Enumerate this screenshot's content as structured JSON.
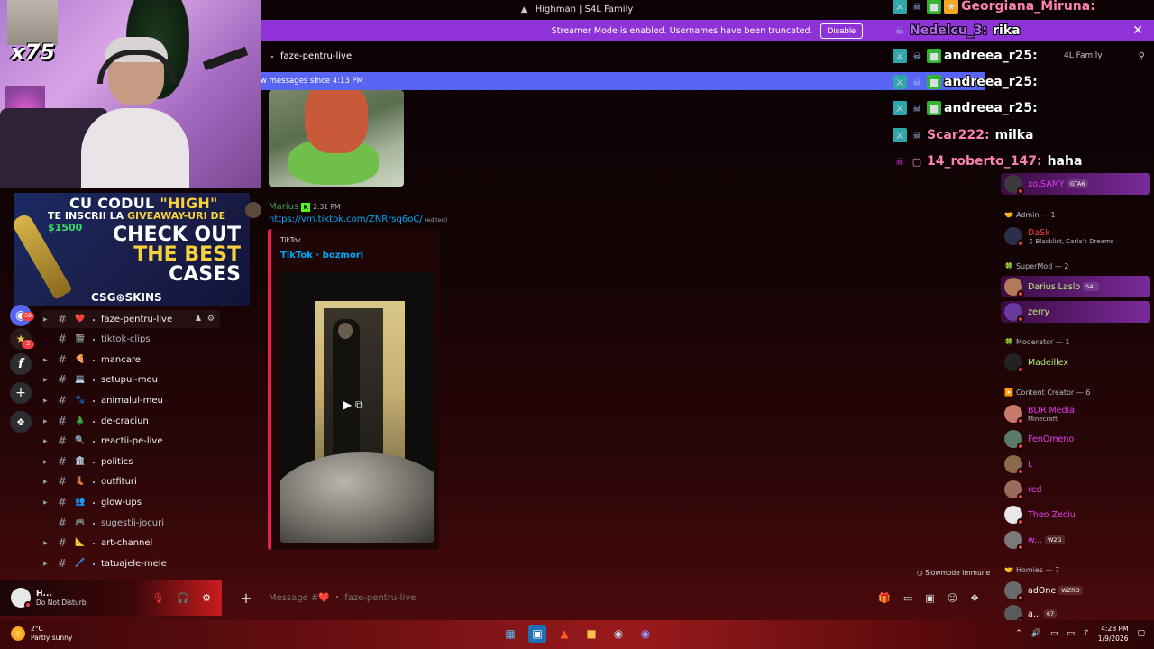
{
  "window": {
    "title": "Highman | S4L Family"
  },
  "streamer_banner": {
    "text": "Streamer Mode is enabled. Usernames have been truncated.",
    "disable_label": "Disable"
  },
  "channel_header": {
    "name": "faze-pentru-live"
  },
  "new_messages_bar": {
    "text": "w messages since 4:13 PM"
  },
  "right_header": {
    "server_name": "4L Family"
  },
  "overlay": {
    "multiplier": "x75"
  },
  "sponsor": {
    "line1_pre": "CU CODUL ",
    "line1_code": "\"HIGH\"",
    "line2_pre": "TE INSCRII LA ",
    "line2_mid": "GIVEAWAY-URI DE ",
    "line2_amount": "$1500",
    "cta_1": "CHECK OUT",
    "cta_2": "THE BEST",
    "cta_3": "CASES",
    "brand": "CSG⊛SKINS"
  },
  "server_rail": {
    "badges": [
      "58",
      "3"
    ]
  },
  "channels": [
    {
      "name": "faze-pentru-live",
      "emoji": "❤️",
      "active": true,
      "muted": false
    },
    {
      "name": "tiktok-clips",
      "emoji": "🎬",
      "active": false,
      "muted": true
    },
    {
      "name": "mancare",
      "emoji": "🍕",
      "active": false,
      "muted": false
    },
    {
      "name": "setupul-meu",
      "emoji": "💻",
      "active": false,
      "muted": false
    },
    {
      "name": "animalul-meu",
      "emoji": "🐾",
      "active": false,
      "muted": false
    },
    {
      "name": "de-craciun",
      "emoji": "🎄",
      "active": false,
      "muted": false
    },
    {
      "name": "reactii-pe-live",
      "emoji": "🔍",
      "active": false,
      "muted": false
    },
    {
      "name": "politics",
      "emoji": "🏛️",
      "active": false,
      "muted": false
    },
    {
      "name": "outfituri",
      "emoji": "👢",
      "active": false,
      "muted": false
    },
    {
      "name": "glow-ups",
      "emoji": "👥",
      "active": false,
      "muted": false
    },
    {
      "name": "sugestii-jocuri",
      "emoji": "🎮",
      "active": false,
      "muted": true
    },
    {
      "name": "art-channel",
      "emoji": "📐",
      "active": false,
      "muted": false
    },
    {
      "name": "tatuajele-mele",
      "emoji": "🖊️",
      "active": false,
      "muted": false
    }
  ],
  "user_panel": {
    "name": "H...",
    "status": "Do Not Disturb"
  },
  "message": {
    "author": "Marius",
    "time": "2:31 PM",
    "link": "https://vm.tiktok.com/ZNRrsq6oC/",
    "edited": "(edited)",
    "embed_provider": "TikTok",
    "embed_title": "TikTok · bozmori"
  },
  "slowmode": "Slowmode Immune",
  "composer": {
    "placeholder": "Message #❤️ ・ faze-pentru-live"
  },
  "member_groups": [
    {
      "label": "Admin — 1",
      "icon": "🤝"
    },
    {
      "label": "SuperMod — 2",
      "icon": "🍀"
    },
    {
      "label": "Moderator — 1",
      "icon": "🍀"
    },
    {
      "label": "Content Creator — 6",
      "icon": "▶️"
    },
    {
      "label": "Homies — 7",
      "icon": "🤝"
    }
  ],
  "members": [
    {
      "name": "xo.SAMY",
      "sub": "",
      "tag": "GTA6",
      "color": "#e23cf0",
      "avatar": "#3b3b3b",
      "highlight": true
    },
    {
      "name": "DaSk",
      "sub": "♫ Blacklist, Carla's Dreams",
      "tag": "",
      "color": "#f23f43",
      "avatar": "#2c2f4a",
      "highlight": false
    },
    {
      "name": "Darius Laslo",
      "sub": "",
      "tag": "S4L",
      "color": "#b9f27c",
      "avatar": "#b37a5a",
      "highlight": true
    },
    {
      "name": "zerry",
      "sub": "",
      "tag": "",
      "color": "#b9f27c",
      "avatar": "#6b3aa0",
      "highlight": true
    },
    {
      "name": "Madeillex",
      "sub": "",
      "tag": "",
      "color": "#b9f27c",
      "avatar": "#222222",
      "highlight": false
    },
    {
      "name": "BDR Media",
      "sub": "Minecraft",
      "tag": "",
      "color": "#e23cf0",
      "avatar": "#c77a6a",
      "highlight": false
    },
    {
      "name": "FenOmeno",
      "sub": "",
      "tag": "",
      "color": "#e23cf0",
      "avatar": "#5a7a6a",
      "highlight": false
    },
    {
      "name": "L",
      "sub": "",
      "tag": "",
      "color": "#e23cf0",
      "avatar": "#8a6a4a",
      "highlight": false
    },
    {
      "name": "red",
      "sub": "",
      "tag": "",
      "color": "#e23cf0",
      "avatar": "#9a6a5a",
      "highlight": false
    },
    {
      "name": "Theo Zeciu",
      "sub": "",
      "tag": "",
      "color": "#e23cf0",
      "avatar": "#e8e8e8",
      "highlight": false
    },
    {
      "name": "w...",
      "sub": "",
      "tag": "W2G",
      "color": "#e23cf0",
      "avatar": "#7a7a7a",
      "highlight": false
    },
    {
      "name": "adOne",
      "sub": "",
      "tag": "WZRO",
      "color": "#ffffff",
      "avatar": "#6a6a6a",
      "highlight": false
    },
    {
      "name": "a...",
      "sub": "",
      "tag": "67",
      "color": "#ffffff",
      "avatar": "#5a5a5a",
      "highlight": false
    }
  ],
  "chat_overlay": [
    {
      "user": "Georgiana_Miruna:",
      "text": "",
      "color": "#ff7fb0"
    },
    {
      "user": "Nedelcu_3:",
      "text": "rika",
      "color": "#b565f0"
    },
    {
      "user": "andreea_r25:",
      "text": "",
      "color": "#ffffff"
    },
    {
      "user": "andreea_r25:",
      "text": "",
      "color": "#ffffff"
    },
    {
      "user": "andreea_r25:",
      "text": "",
      "color": "#ffffff"
    },
    {
      "user": "Scar222:",
      "text": "milka",
      "color": "#ff7fb0"
    },
    {
      "user": "14_roberto_147:",
      "text": "haha",
      "color": "#ff7fb0"
    }
  ],
  "taskbar": {
    "temp": "2°C",
    "weather": "Partly sunny",
    "time": "4:28 PM",
    "date": "1/9/2026"
  }
}
